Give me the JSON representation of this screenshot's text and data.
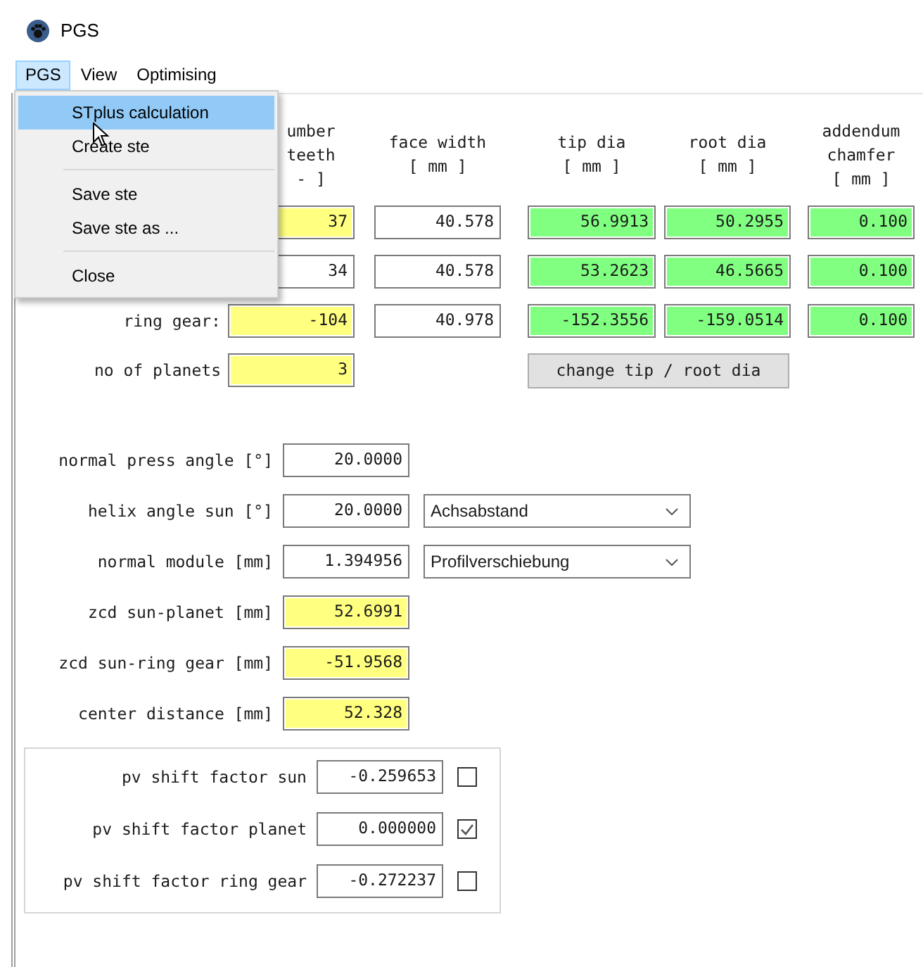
{
  "window": {
    "title": "PGS"
  },
  "menu_bar": [
    {
      "label": "PGS",
      "selected": true
    },
    {
      "label": "View",
      "selected": false
    },
    {
      "label": "Optimising",
      "selected": false
    }
  ],
  "menu": [
    {
      "kind": "item",
      "label": "STplus calculation",
      "selected": true
    },
    {
      "kind": "item",
      "label": "Create ste",
      "selected": false
    },
    {
      "kind": "separator"
    },
    {
      "kind": "item",
      "label": "Save ste",
      "selected": false
    },
    {
      "kind": "item",
      "label": "Save ste as ...",
      "selected": false
    },
    {
      "kind": "separator"
    },
    {
      "kind": "item",
      "label": "Close",
      "selected": false
    }
  ],
  "gear_table": {
    "columns": [
      {
        "lines": [
          "umber",
          "teeth",
          "- ]"
        ]
      },
      {
        "lines": [
          "face width",
          "[ mm ]"
        ]
      },
      {
        "lines": [
          "tip dia",
          "[ mm ]"
        ]
      },
      {
        "lines": [
          "root dia",
          "[ mm ]"
        ]
      },
      {
        "lines": [
          "addendum",
          "chamfer",
          "[ mm ]"
        ]
      }
    ],
    "rows": [
      {
        "cells": [
          {
            "value": "37",
            "color": "#ffff80"
          },
          {
            "value": "40.578",
            "color": "#ffffff"
          },
          {
            "value": "56.9913",
            "color": "#80ff80"
          },
          {
            "value": "50.2955",
            "color": "#80ff80"
          },
          {
            "value": "0.100",
            "color": "#80ff80"
          }
        ]
      },
      {
        "cells": [
          {
            "value": "34",
            "color": "#ffffff"
          },
          {
            "value": "40.578",
            "color": "#ffffff"
          },
          {
            "value": "53.2623",
            "color": "#80ff80"
          },
          {
            "value": "46.5665",
            "color": "#80ff80"
          },
          {
            "value": "0.100",
            "color": "#80ff80"
          }
        ]
      },
      {
        "label": "ring gear:",
        "cells": [
          {
            "value": "-104",
            "color": "#ffff80"
          },
          {
            "value": "40.978",
            "color": "#ffffff"
          },
          {
            "value": "-152.3556",
            "color": "#80ff80"
          },
          {
            "value": "-159.0514",
            "color": "#80ff80"
          },
          {
            "value": "0.100",
            "color": "#80ff80"
          }
        ]
      }
    ]
  },
  "planets": {
    "label": "no of planets",
    "value": "3",
    "color": "#ffff80"
  },
  "change_button": "change tip / root dia",
  "parameters": [
    {
      "label": "normal press angle [°]",
      "value": "20.0000",
      "color": "#ffffff"
    },
    {
      "label": "helix angle sun [°]",
      "value": "20.0000",
      "color": "#ffffff",
      "dropdown": "Achsabstand"
    },
    {
      "label": "normal module [mm]",
      "value": "1.394956",
      "color": "#ffffff",
      "dropdown": "Profilverschiebung"
    }
  ],
  "results": [
    {
      "label": "zcd sun-planet [mm]",
      "value": "52.6991",
      "color": "#ffff80"
    },
    {
      "label": "zcd sun-ring gear [mm]",
      "value": "-51.9568",
      "color": "#ffff80"
    },
    {
      "label": "center distance [mm]",
      "value": "52.328",
      "color": "#ffff80"
    }
  ],
  "shift_factors": [
    {
      "label": "pv shift factor sun",
      "value": "-0.259653",
      "checked": false
    },
    {
      "label": "pv shift factor planet",
      "value": "0.000000",
      "checked": true
    },
    {
      "label": "pv shift factor ring gear",
      "value": "-0.272237",
      "checked": false
    }
  ]
}
